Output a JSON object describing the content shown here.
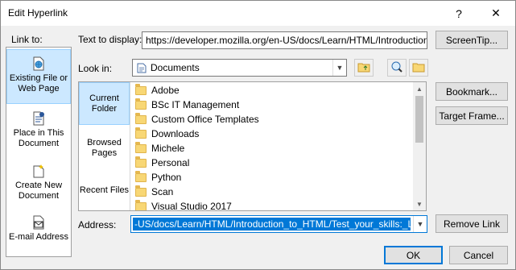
{
  "window": {
    "title": "Edit Hyperlink",
    "help_glyph": "?",
    "close_glyph": "✕"
  },
  "link_to": {
    "label": "Link to:",
    "items": [
      {
        "label": "Existing File or Web Page",
        "icon": "globe-page-icon",
        "selected": true
      },
      {
        "label": "Place in This Document",
        "icon": "document-place-icon",
        "selected": false
      },
      {
        "label": "Create New Document",
        "icon": "new-document-icon",
        "selected": false
      },
      {
        "label": "E-mail Address",
        "icon": "email-icon",
        "selected": false
      }
    ]
  },
  "text_to_display": {
    "label": "Text to display:",
    "value": "https://developer.mozilla.org/en-US/docs/Learn/HTML/Introduction_"
  },
  "screentip_button": "ScreenTip...",
  "look_in": {
    "label": "Look in:",
    "value": "Documents"
  },
  "nav": {
    "items": [
      {
        "label": "Current Folder",
        "selected": true
      },
      {
        "label": "Browsed Pages",
        "selected": false
      },
      {
        "label": "Recent Files",
        "selected": false
      }
    ]
  },
  "files": [
    "Adobe",
    "BSc IT Management",
    "Custom Office Templates",
    "Downloads",
    "Michele",
    "Personal",
    "Python",
    "Scan",
    "Visual Studio 2017"
  ],
  "side_buttons": {
    "bookmark": "Bookmark...",
    "target_frame": "Target Frame..."
  },
  "address": {
    "label": "Address:",
    "value": "-US/docs/Learn/HTML/Introduction_to_HTML/Test_your_skills:_Links"
  },
  "remove_link_button": "Remove Link",
  "ok_button": "OK",
  "cancel_button": "Cancel",
  "colors": {
    "selection": "#cce8ff",
    "selection_border": "#99d1ff",
    "address_highlight": "#0078d7",
    "folder": "#f8d775"
  }
}
